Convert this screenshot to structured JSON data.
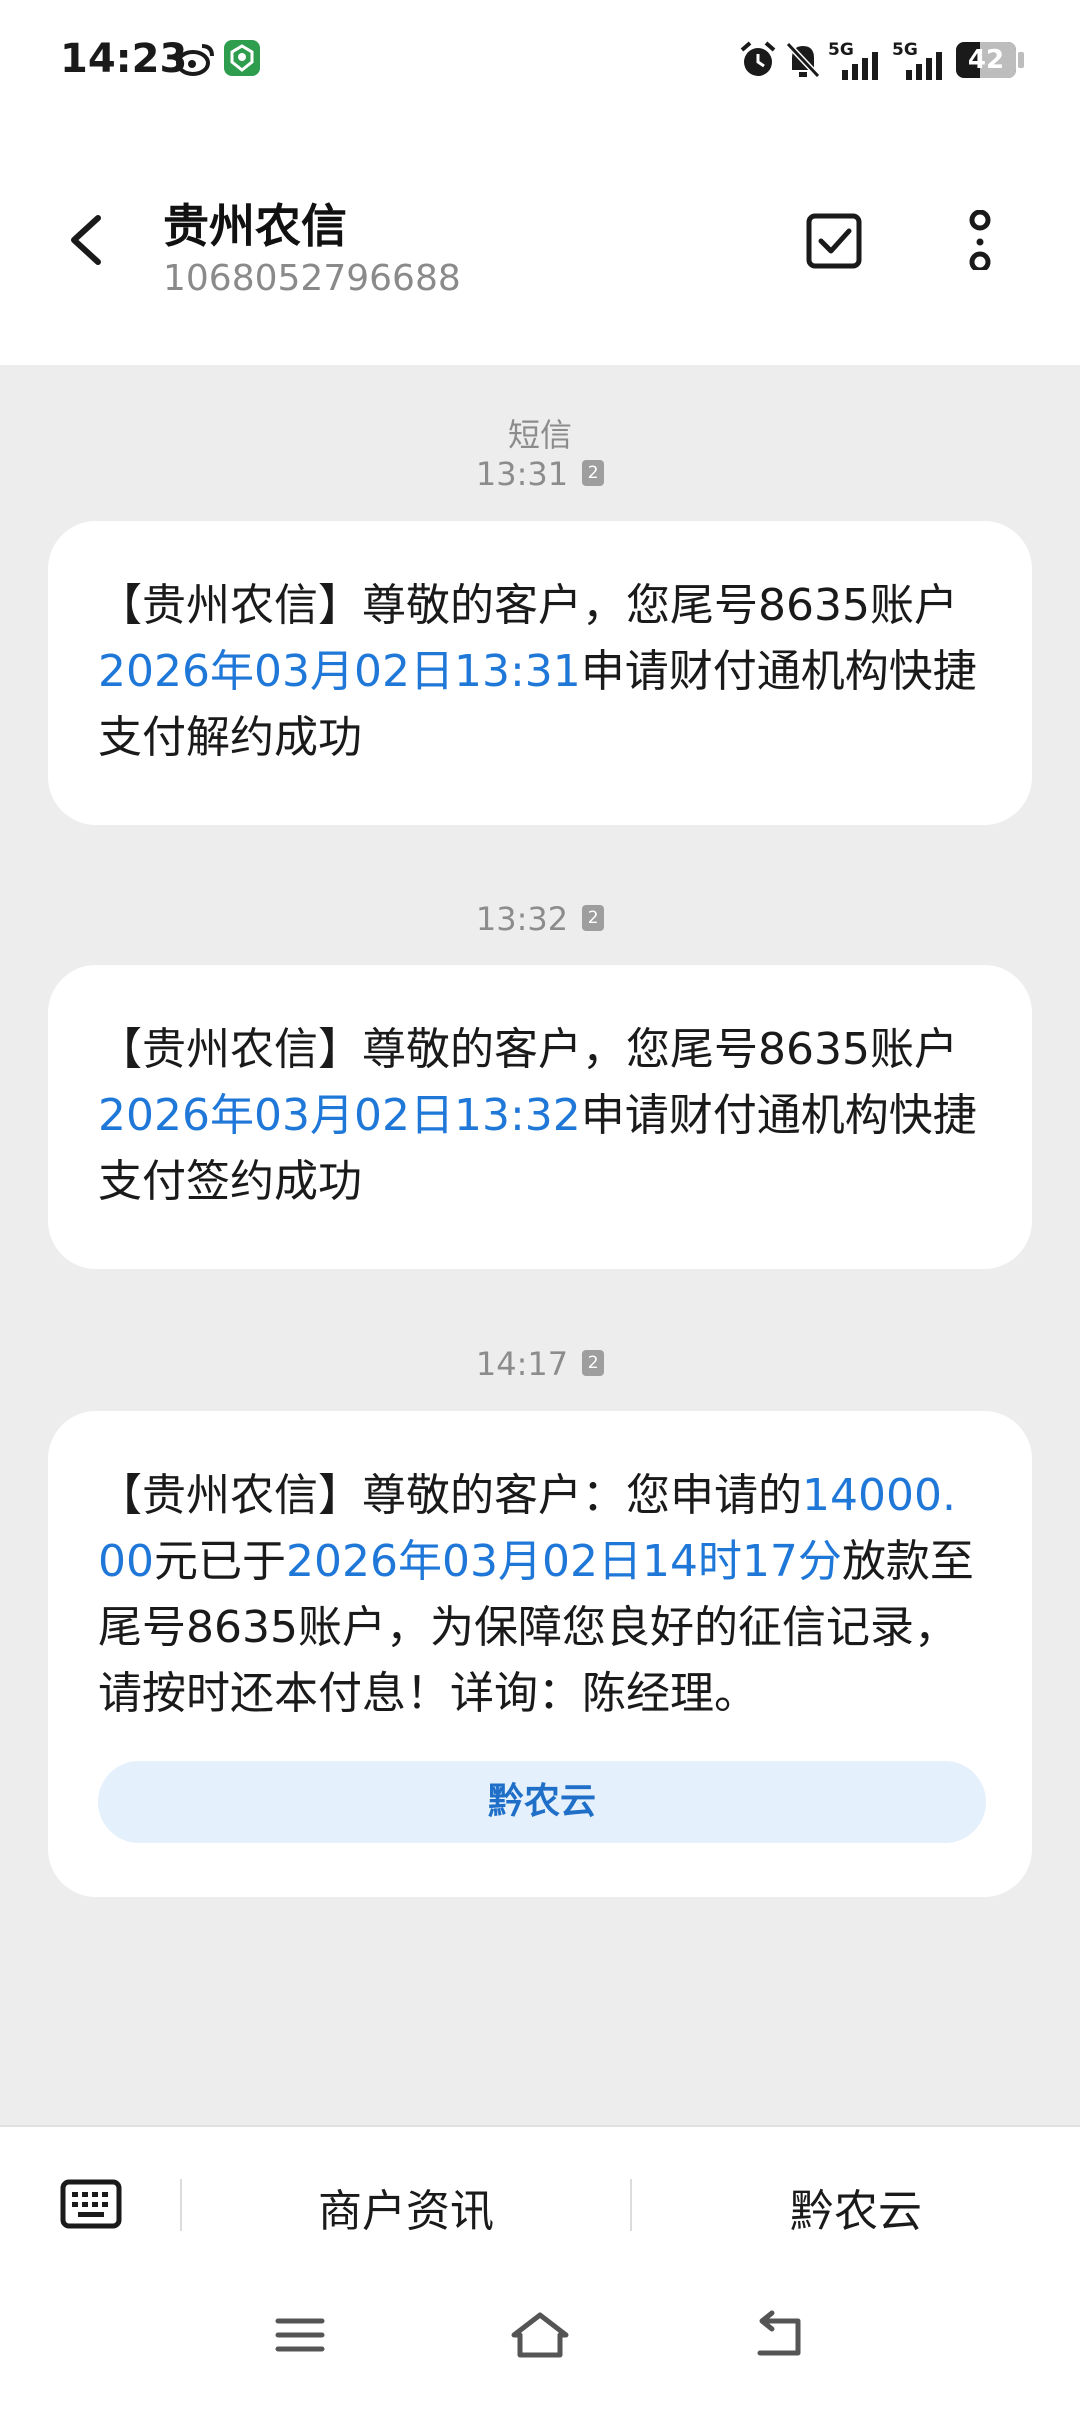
{
  "status_bar": {
    "time": "14:23",
    "network1": "5G",
    "network2": "5G",
    "battery": "42",
    "icons": [
      "weibo-icon",
      "app-shield-icon",
      "alarm-icon",
      "mute-bell-icon",
      "signal-icon",
      "signal-icon",
      "battery-icon"
    ]
  },
  "header": {
    "title": "贵州农信",
    "number": "1068052796688",
    "icons": [
      "back-arrow-icon",
      "checkbox-select-icon",
      "more-vertical-icon"
    ]
  },
  "conversation": {
    "type_label": "短信",
    "sim_badge": "2",
    "messages": [
      {
        "time": "13:31",
        "parts": [
          {
            "text": "【贵州农信】尊敬的客户，您尾号8635账户"
          },
          {
            "text": "2026年03月02日13:31",
            "link": true
          },
          {
            "text": "申请财付通机构快捷支付解约成功"
          }
        ]
      },
      {
        "time": "13:32",
        "parts": [
          {
            "text": "【贵州农信】尊敬的客户，您尾号8635账户"
          },
          {
            "text": "2026年03月02日13:32",
            "link": true
          },
          {
            "text": "申请财付通机构快捷支付签约成功"
          }
        ]
      },
      {
        "time": "14:17",
        "parts": [
          {
            "text": "【贵州农信】尊敬的客户：您申请的"
          },
          {
            "text": "14000.00",
            "link": true
          },
          {
            "text": "元已于"
          },
          {
            "text": "2026年03月02日14时17分",
            "link": true
          },
          {
            "text": "放款至尾号8635账户，为保障您良好的征信记录，请按时还本付息！详询：陈经理。"
          }
        ],
        "action_button": "黔农云"
      }
    ]
  },
  "bottom_menu": {
    "keyboard_icon": "keyboard-icon",
    "item1": "商户资讯",
    "item2": "黔农云"
  },
  "nav_bar": {
    "icons": [
      "menu-nav-icon",
      "home-nav-icon",
      "back-nav-icon"
    ]
  },
  "colors": {
    "link": "#1f78d8",
    "background": "#ededed",
    "bubble": "#ffffff",
    "button_bg": "#e4f0fc"
  }
}
